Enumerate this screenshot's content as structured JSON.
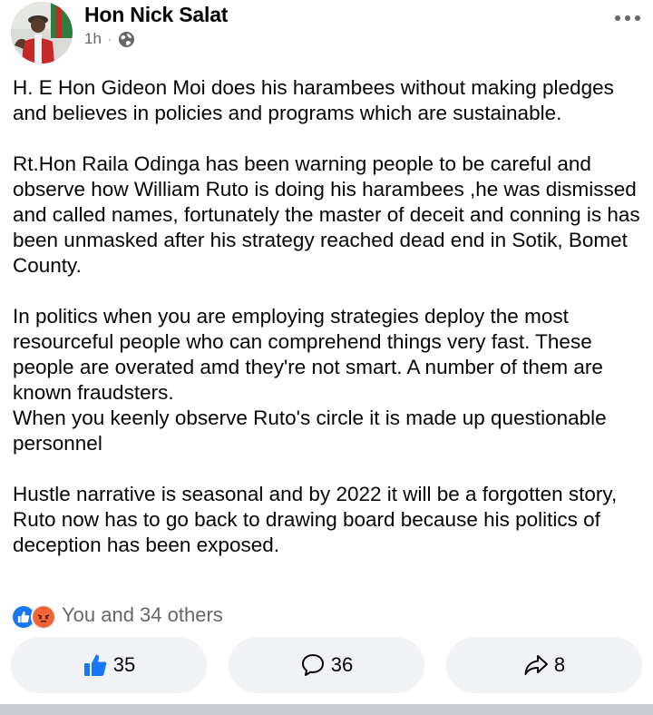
{
  "post": {
    "author": "Hon Nick Salat",
    "time": "1h",
    "separator": "·",
    "privacy_icon": "globe-icon",
    "paragraphs": [
      "H. E Hon Gideon Moi does his harambees without making pledges and believes in policies and programs which are sustainable.",
      "Rt.Hon Raila Odinga has been warning people to be careful and observe how William Ruto is doing his harambees ,he was dismissed and called names, fortunately the master of deceit and conning is has been unmasked after his strategy reached dead end in Sotik, Bomet County.",
      "In politics when you are employing strategies deploy the most resourceful people who can comprehend things very fast. These people are overated amd they're not smart. A number of them are known fraudsters.\nWhen you keenly observe Ruto's circle it is made up questionable personnel",
      "Hustle narrative is seasonal and by 2022 it will be a forgotten story, Ruto now has to go back to drawing board because his politics of deception has been exposed."
    ]
  },
  "reactions": {
    "icons": [
      "like-reaction-icon",
      "angry-reaction-icon"
    ],
    "summary": "You and 34 others"
  },
  "actions": {
    "like_count": "35",
    "comment_count": "36",
    "share_count": "8"
  },
  "colors": {
    "brand_blue": "#1877f2",
    "secondary_text": "#65676b",
    "button_bg": "#f0f2f5",
    "angry": "#f0663a"
  }
}
